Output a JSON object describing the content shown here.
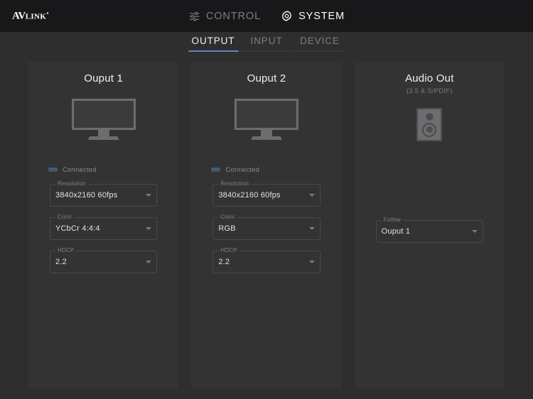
{
  "header": {
    "logo": {
      "primary": "AV",
      "secondary": "LINK"
    },
    "nav": [
      {
        "label": "CONTROL",
        "icon": "sliders-icon",
        "active": false
      },
      {
        "label": "SYSTEM",
        "icon": "gear-icon",
        "active": true
      }
    ]
  },
  "tabs": [
    {
      "label": "OUTPUT",
      "active": true
    },
    {
      "label": "INPUT",
      "active": false
    },
    {
      "label": "DEVICE",
      "active": false
    }
  ],
  "accent_color": "#5b89bd",
  "cards": [
    {
      "title": "Ouput 1",
      "subtitle": "",
      "device_icon": "monitor-icon",
      "status": {
        "icon": "hdmi-connector-icon",
        "label": "Connected",
        "color": "#4f7fa8"
      },
      "fields": [
        {
          "label": "Resolution",
          "value": "3840x2160 60fps"
        },
        {
          "label": "Color",
          "value": "YCbCr 4:4:4"
        },
        {
          "label": "HDCP",
          "value": "2.2"
        }
      ]
    },
    {
      "title": "Ouput 2",
      "subtitle": "",
      "device_icon": "monitor-icon",
      "status": {
        "icon": "hdmi-connector-icon",
        "label": "Connected",
        "color": "#4f7fa8"
      },
      "fields": [
        {
          "label": "Resolution",
          "value": "3840x2160 60fps"
        },
        {
          "label": "Color",
          "value": "RGB"
        },
        {
          "label": "HDCP",
          "value": "2.2"
        }
      ]
    },
    {
      "title": "Audio Out",
      "subtitle": "(3.5 & S/PDIF)",
      "device_icon": "speaker-icon",
      "status": null,
      "fields": [
        {
          "label": "Follow",
          "value": "Ouput 1"
        }
      ]
    }
  ]
}
